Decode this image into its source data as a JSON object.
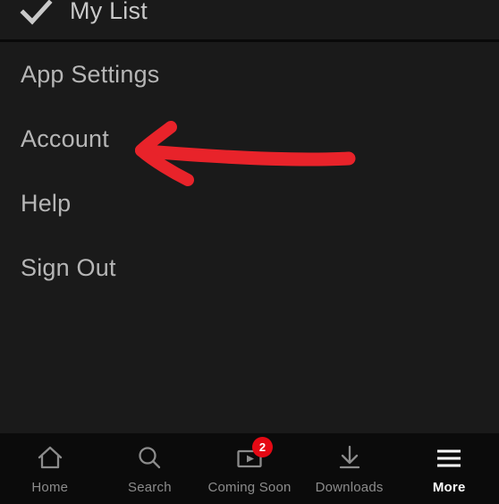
{
  "colors": {
    "background": "#1a1a1a",
    "tabbar_background": "#0b0b0b",
    "divider": "#090909",
    "text": "#b6b6b6",
    "text_active": "#ffffff",
    "icon": "#8c8c8c",
    "accent_red": "#e50914",
    "annotation_red": "#e8232a"
  },
  "top_row": {
    "icon": "check-icon",
    "label": "My List"
  },
  "menu": {
    "items": [
      {
        "label": "App Settings"
      },
      {
        "label": "Account"
      },
      {
        "label": "Help"
      },
      {
        "label": "Sign Out"
      }
    ]
  },
  "annotation": {
    "type": "arrow",
    "color": "#e8232a",
    "points_to": "Account",
    "direction": "left"
  },
  "tabbar": {
    "items": [
      {
        "label": "Home",
        "icon": "home-icon",
        "active": false,
        "badge": null
      },
      {
        "label": "Search",
        "icon": "search-icon",
        "active": false,
        "badge": null
      },
      {
        "label": "Coming Soon",
        "icon": "coming-soon-icon",
        "active": false,
        "badge": "2"
      },
      {
        "label": "Downloads",
        "icon": "download-icon",
        "active": false,
        "badge": null
      },
      {
        "label": "More",
        "icon": "hamburger-icon",
        "active": true,
        "badge": null
      }
    ]
  }
}
